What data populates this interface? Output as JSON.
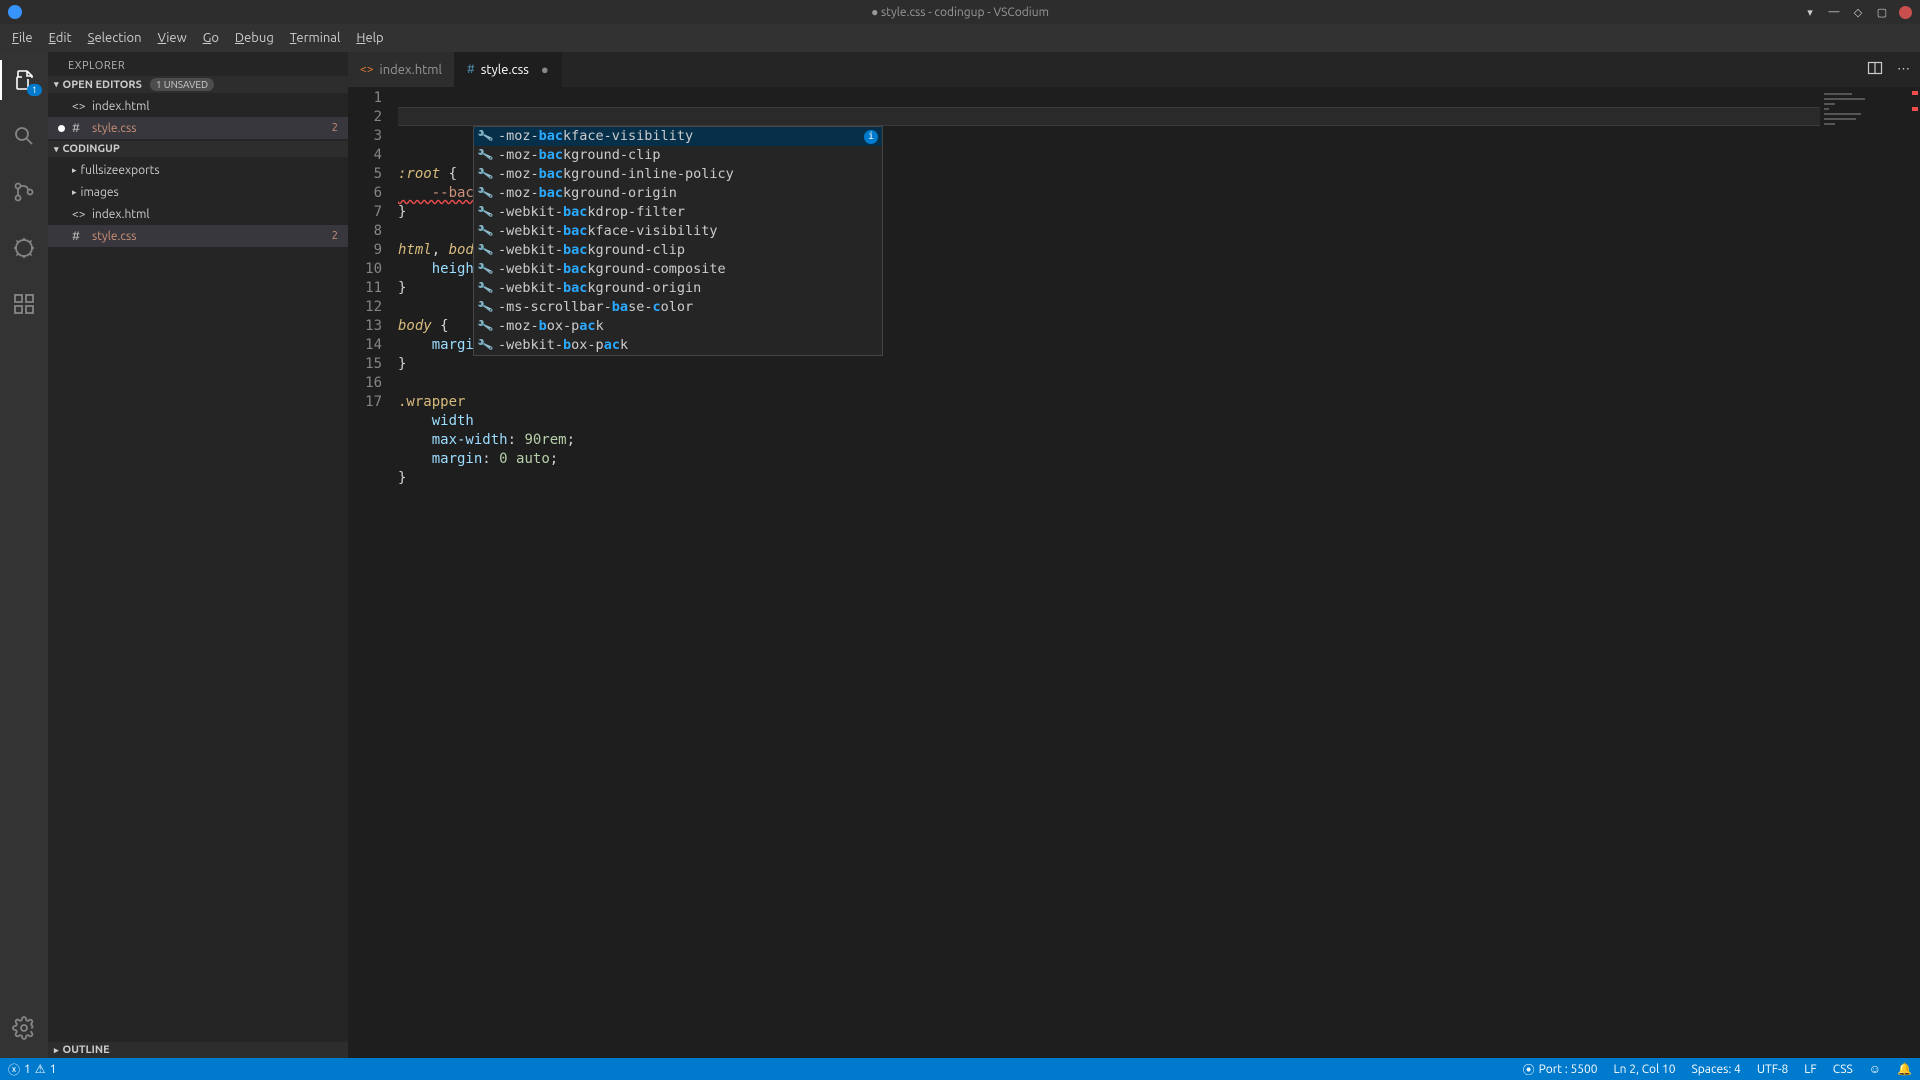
{
  "titlebar": {
    "title": "● style.css - codingup - VSCodium"
  },
  "menu": [
    "File",
    "Edit",
    "Selection",
    "View",
    "Go",
    "Debug",
    "Terminal",
    "Help"
  ],
  "activitybar": {
    "badge": "1"
  },
  "sidebar": {
    "title": "EXPLORER",
    "open_editors": {
      "label": "OPEN EDITORS",
      "unsaved": "1 UNSAVED",
      "items": [
        {
          "name": "index.html",
          "icon": "<>",
          "unsaved": false,
          "errors": ""
        },
        {
          "name": "style.css",
          "icon": "#",
          "unsaved": true,
          "errors": "2"
        }
      ]
    },
    "folder": {
      "label": "CODINGUP",
      "items": [
        {
          "name": "fullsizeexports",
          "type": "folder",
          "expanded": false
        },
        {
          "name": "images",
          "type": "folder",
          "expanded": false
        },
        {
          "name": "index.html",
          "type": "file",
          "icon": "<>"
        },
        {
          "name": "style.css",
          "type": "file",
          "icon": "#",
          "errors": "2",
          "active": true
        }
      ]
    },
    "outline_label": "OUTLINE"
  },
  "tabs": [
    {
      "name": "index.html",
      "icon": "<>",
      "active": false,
      "dirty": false
    },
    {
      "name": "style.css",
      "icon": "#",
      "active": true,
      "dirty": true
    }
  ],
  "code_lines": [
    {
      "n": 1,
      "segments": [
        [
          "sel",
          ":root"
        ],
        [
          "punc",
          " {"
        ]
      ]
    },
    {
      "n": 2,
      "segments": [
        [
          "err",
          "    --bac"
        ]
      ],
      "cursor": true
    },
    {
      "n": 3,
      "segments": [
        [
          "punc",
          "}"
        ]
      ]
    },
    {
      "n": 4,
      "segments": [
        [
          "",
          ""
        ]
      ]
    },
    {
      "n": 5,
      "segments": [
        [
          "sel",
          "html"
        ],
        [
          "punc",
          ", "
        ],
        [
          "sel",
          "bod"
        ]
      ]
    },
    {
      "n": 6,
      "segments": [
        [
          "prop",
          "    heigh"
        ]
      ]
    },
    {
      "n": 7,
      "segments": [
        [
          "punc",
          "}"
        ]
      ]
    },
    {
      "n": 8,
      "segments": [
        [
          "",
          ""
        ]
      ]
    },
    {
      "n": 9,
      "segments": [
        [
          "sel",
          "body"
        ],
        [
          "punc",
          " {"
        ]
      ]
    },
    {
      "n": 10,
      "segments": [
        [
          "prop",
          "    margi"
        ]
      ]
    },
    {
      "n": 11,
      "segments": [
        [
          "punc",
          "}"
        ]
      ]
    },
    {
      "n": 12,
      "segments": [
        [
          "",
          ""
        ]
      ]
    },
    {
      "n": 13,
      "segments": [
        [
          "class",
          ".wrapper"
        ]
      ]
    },
    {
      "n": 14,
      "segments": [
        [
          "prop",
          "    width"
        ]
      ]
    },
    {
      "n": 15,
      "segments": [
        [
          "prop",
          "    max-width"
        ],
        [
          "punc",
          ": "
        ],
        [
          "num",
          "90rem"
        ],
        [
          "punc",
          ";"
        ]
      ]
    },
    {
      "n": 16,
      "segments": [
        [
          "prop",
          "    margin"
        ],
        [
          "punc",
          ": "
        ],
        [
          "num",
          "0"
        ],
        [
          "punc",
          " "
        ],
        [
          "num",
          "auto"
        ],
        [
          "punc",
          ";"
        ]
      ]
    },
    {
      "n": 17,
      "segments": [
        [
          "punc",
          "}"
        ]
      ]
    }
  ],
  "suggestions": [
    {
      "pre": "-moz-",
      "hl": "bac",
      "post": "kface-visibility",
      "sel": true,
      "info": true
    },
    {
      "pre": "-moz-",
      "hl": "bac",
      "post": "kground-clip"
    },
    {
      "pre": "-moz-",
      "hl": "bac",
      "post": "kground-inline-policy"
    },
    {
      "pre": "-moz-",
      "hl": "bac",
      "post": "kground-origin"
    },
    {
      "pre": "-webkit-",
      "hl": "bac",
      "post": "kdrop-filter"
    },
    {
      "pre": "-webkit-",
      "hl": "bac",
      "post": "kface-visibility"
    },
    {
      "pre": "-webkit-",
      "hl": "bac",
      "post": "kground-clip"
    },
    {
      "pre": "-webkit-",
      "hl": "bac",
      "post": "kground-composite"
    },
    {
      "pre": "-webkit-",
      "hl": "bac",
      "post": "kground-origin"
    },
    {
      "pre": "-ms-scrollbar-",
      "hl": "ba",
      "post": "se-",
      "hl2": "c",
      "post2": "olor"
    },
    {
      "pre": "-moz-",
      "hl": "b",
      "post": "ox-p",
      "hl2": "ac",
      "post2": "k"
    },
    {
      "pre": "-webkit-",
      "hl": "b",
      "post": "ox-p",
      "hl2": "ac",
      "post2": "k"
    }
  ],
  "statusbar": {
    "errors": "1",
    "warnings": "1",
    "port": "Port : 5500",
    "lncol": "Ln 2, Col 10",
    "spaces": "Spaces: 4",
    "encoding": "UTF-8",
    "eol": "LF",
    "lang": "CSS"
  }
}
